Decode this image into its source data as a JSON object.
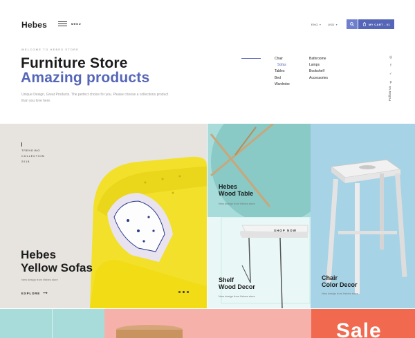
{
  "header": {
    "logo": "Hebes",
    "menu_label": "MENU",
    "language": "ENG",
    "currency": "USD",
    "cart_label": "MY CART - 01",
    "search_icon": "search-icon",
    "cart_icon": "cart-icon"
  },
  "hero": {
    "welcome": "WELCOME TO HEBES STORE",
    "title_line1": "Furniture Store",
    "title_line2": "Amazing products",
    "description": "Unique Design, Great Products. The perfect choice for you. Please choose a collections product than you love here."
  },
  "categories": {
    "col1": [
      "Chair",
      "Sofas",
      "Tables",
      "Bed",
      "Wardrobe"
    ],
    "col2": [
      "Bathroome",
      "Lamps",
      "Bookshelf",
      "Accessories"
    ],
    "active": "Sofas"
  },
  "social": {
    "icons": [
      "instagram-icon",
      "facebook-icon",
      "twitter-icon",
      "pinterest-icon"
    ],
    "follow_label": "Follow us"
  },
  "tiles": {
    "sofa": {
      "trending_line1": "TRENDING",
      "trending_line2": "COLLECTION",
      "trending_line3": "2018",
      "title_line1": "Hebes",
      "title_line2": "Yellow Sofas",
      "subtitle": "New design from Hebes store",
      "explore": "EXPLORE"
    },
    "table": {
      "title_line1": "Hebes",
      "title_line2": "Wood Table",
      "subtitle": "New design from Hebes store"
    },
    "shelf": {
      "shop_now": "SHOP NOW",
      "title_line1": "Shelf",
      "title_line2": "Wood Decor",
      "subtitle": "New design from Hebes store"
    },
    "chair": {
      "title_line1": "Chair",
      "title_line2": "Color Decor",
      "subtitle": "New design from Hebes store"
    },
    "sale": "Sale"
  },
  "colors": {
    "accent": "#5566b8",
    "teal": "#a7dcda",
    "sky": "#a7d3e6",
    "coral": "#f16a4f",
    "pink": "#f6b2aa",
    "yellow": "#f3e02a"
  }
}
